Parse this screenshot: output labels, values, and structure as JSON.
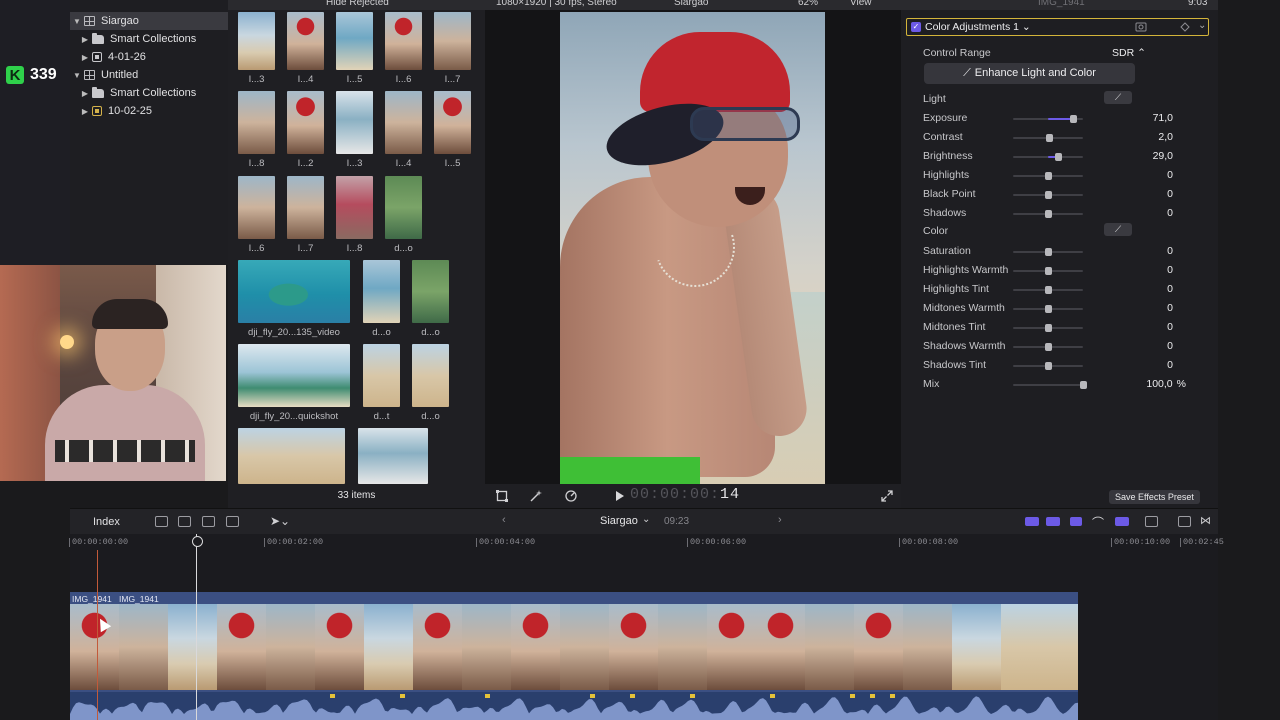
{
  "overlay": {
    "k_count": "339"
  },
  "topbar": {
    "hide_rejected": "Hide Rejected",
    "clip_format": "1080×1920 | 30 fps, Stereo",
    "viewer_title": "Siargao",
    "zoom": "62%",
    "view": "View",
    "inspector_clip": "IMG_1941",
    "inspector_time": "9:03"
  },
  "libraries": [
    {
      "label": "Siargao",
      "kind": "library",
      "expanded": true,
      "selected": true
    },
    {
      "label": "Smart Collections",
      "kind": "folder",
      "expanded": false
    },
    {
      "label": "4-01-26",
      "kind": "event",
      "expanded": false
    },
    {
      "label": "Untitled",
      "kind": "library",
      "expanded": true
    },
    {
      "label": "Smart Collections",
      "kind": "folder",
      "expanded": false
    },
    {
      "label": "10-02-25",
      "kind": "event-gold",
      "expanded": false
    }
  ],
  "browser": {
    "clips": [
      {
        "label": "I...3",
        "art": "t-beach"
      },
      {
        "label": "I...4",
        "art": "t-red"
      },
      {
        "label": "I...5",
        "art": "t-sea"
      },
      {
        "label": "I...6",
        "art": "t-red"
      },
      {
        "label": "I...7",
        "art": "t-person"
      },
      {
        "label": "I...8",
        "art": "t-person"
      },
      {
        "label": "I...2",
        "art": "t-red"
      },
      {
        "label": "I...3",
        "art": "t-boat"
      },
      {
        "label": "I...4",
        "art": "t-person"
      },
      {
        "label": "I...5",
        "art": "t-red"
      },
      {
        "label": "I...6",
        "art": "t-person"
      },
      {
        "label": "I...7",
        "art": "t-person"
      },
      {
        "label": "I...8",
        "art": "t-flowers"
      },
      {
        "label": "d...o",
        "art": "t-green"
      },
      {
        "label": "dji_fly_20...135_video",
        "art": "t-aerial"
      },
      {
        "label": "d...o",
        "art": "t-sea"
      },
      {
        "label": "d...o",
        "art": "t-green"
      },
      {
        "label": "dji_fly_20...quickshot",
        "art": "t-aerial2"
      },
      {
        "label": "d...t",
        "art": "t-sand"
      },
      {
        "label": "d...o",
        "art": "t-sand"
      }
    ],
    "items_count": "33 items"
  },
  "viewer": {
    "timecode_dim": "00:00:00:",
    "timecode_frames": "14"
  },
  "inspector": {
    "effect_title": "Color Adjustments 1 ⌄",
    "control_range_label": "Control Range",
    "control_range_value": "SDR ⌃",
    "enhance_label": "Enhance Light and Color",
    "sections": {
      "light": "Light",
      "color": "Color"
    },
    "params": [
      {
        "name": "Exposure",
        "value": "71,0",
        "level": 0.855
      },
      {
        "name": "Contrast",
        "value": "2,0",
        "level": 0.51
      },
      {
        "name": "Brightness",
        "value": "29,0",
        "level": 0.645
      },
      {
        "name": "Highlights",
        "value": "0",
        "level": 0.5
      },
      {
        "name": "Black Point",
        "value": "0",
        "level": 0.5
      },
      {
        "name": "Shadows",
        "value": "0",
        "level": 0.5
      },
      {
        "name": "Saturation",
        "value": "0",
        "level": 0.5
      },
      {
        "name": "Highlights Warmth",
        "value": "0",
        "level": 0.5
      },
      {
        "name": "Highlights Tint",
        "value": "0",
        "level": 0.5
      },
      {
        "name": "Midtones Warmth",
        "value": "0",
        "level": 0.5
      },
      {
        "name": "Midtones Tint",
        "value": "0",
        "level": 0.5
      },
      {
        "name": "Shadows Warmth",
        "value": "0",
        "level": 0.5
      },
      {
        "name": "Shadows Tint",
        "value": "0",
        "level": 0.5
      },
      {
        "name": "Mix",
        "value": "100,0",
        "unit": "%",
        "level": 1.0
      }
    ],
    "save_preset": "Save Effects Preset"
  },
  "timeline": {
    "index_label": "Index",
    "project_name": "Siargao",
    "duration": "09:23",
    "ruler": [
      "00:00:00:00",
      "00:00:02:00",
      "00:00:04:00",
      "00:00:06:00",
      "00:00:08:00",
      "00:00:10:00",
      "00:02:45"
    ],
    "clip_names": [
      "IMG_1941",
      "IMG_1941"
    ]
  },
  "colors": {
    "accent_purple": "#6c5ae6",
    "selection_gold": "#d3b43a",
    "clip_blue": "#3b4f82",
    "audio_blue": "#2a3f6d"
  }
}
